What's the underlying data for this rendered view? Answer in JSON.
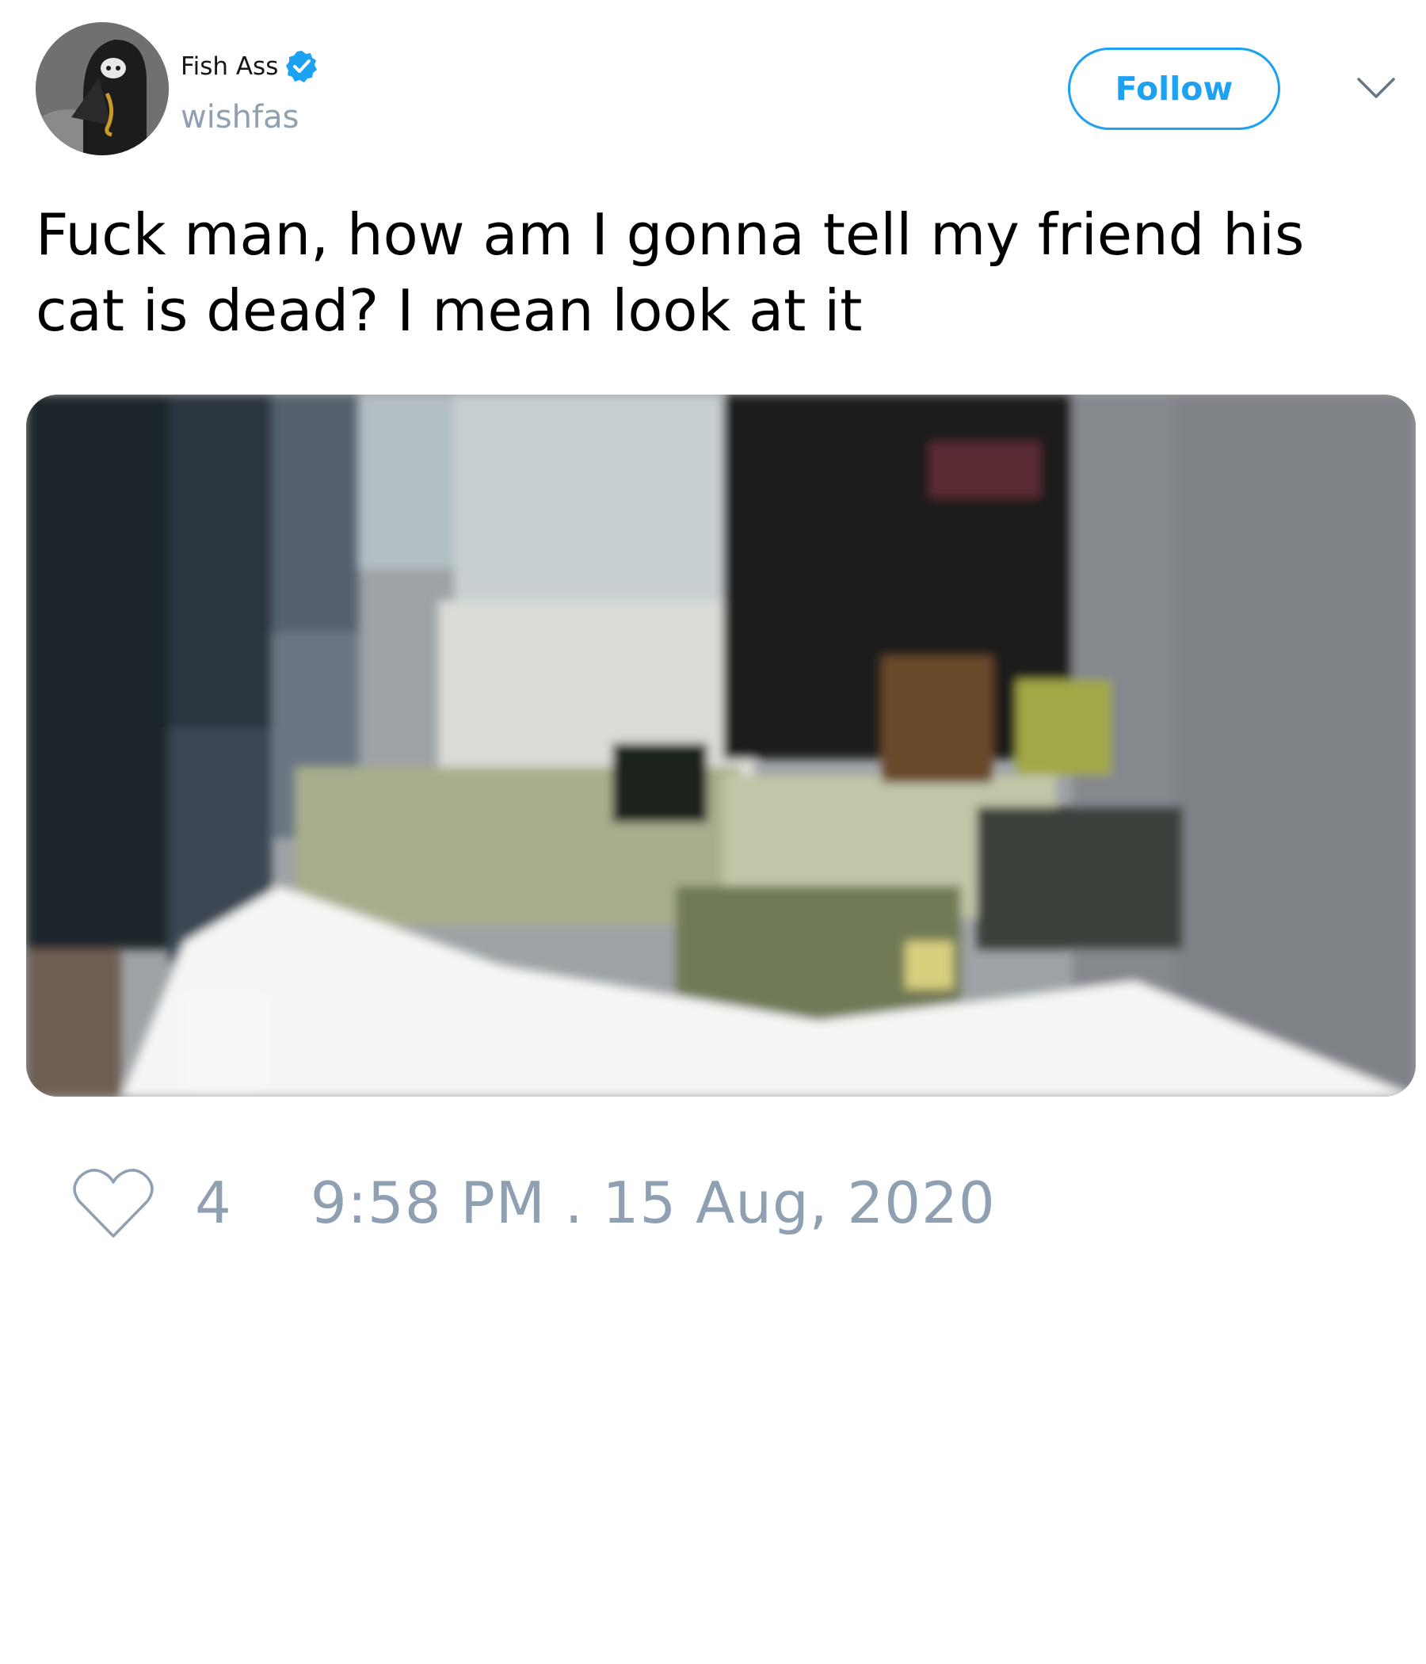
{
  "user": {
    "display_name": "Fish Ass",
    "handle": "wishfas",
    "verified": true,
    "avatar_icon": "hooded-figure-avatar"
  },
  "header": {
    "follow_label": "Follow",
    "menu_icon": "chevron-down-icon"
  },
  "tweet": {
    "text": "Fuck man, how am I gonna tell my friend his cat is dead? I mean look at it",
    "media_description": "pixelated photo of a cat lying on a white surface"
  },
  "footer": {
    "like_icon": "heart-outline-icon",
    "like_count": "4",
    "timestamp": "9:58 PM . 15 Aug, 2020"
  },
  "colors": {
    "accent": "#1da1f2",
    "muted": "#8fa0b2",
    "text": "#000000"
  }
}
